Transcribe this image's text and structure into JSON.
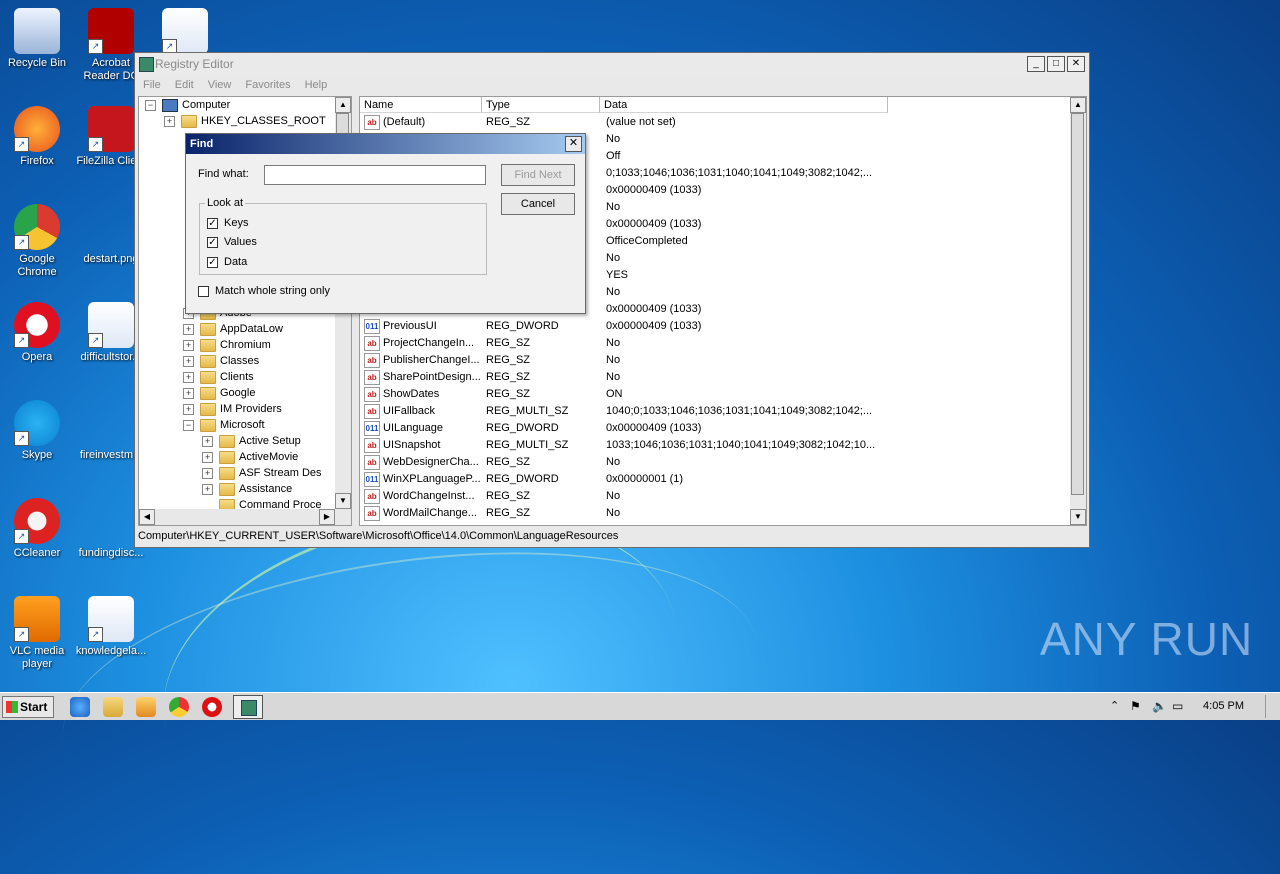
{
  "desktop": {
    "icons": [
      {
        "label": "Recycle Bin",
        "icon": "recycle-bin-icon"
      },
      {
        "label": "Acrobat Reader DC",
        "icon": "acrobat-icon"
      },
      {
        "label": "",
        "icon": "word-doc-icon"
      },
      {
        "label": "Firefox",
        "icon": "firefox-icon"
      },
      {
        "label": "FileZilla Client",
        "icon": "filezilla-icon"
      },
      {
        "label": "Google Chrome",
        "icon": "chrome-icon"
      },
      {
        "label": "destart.png",
        "icon": "image-file-icon"
      },
      {
        "label": "Opera",
        "icon": "opera-icon"
      },
      {
        "label": "difficultstor...",
        "icon": "word-doc-icon"
      },
      {
        "label": "Skype",
        "icon": "skype-icon"
      },
      {
        "label": "fireinvestm...",
        "icon": "file-icon"
      },
      {
        "label": "CCleaner",
        "icon": "ccleaner-icon"
      },
      {
        "label": "fundingdisc...",
        "icon": "file-icon"
      },
      {
        "label": "VLC media player",
        "icon": "vlc-icon"
      },
      {
        "label": "knowledgela...",
        "icon": "word-doc-icon"
      }
    ]
  },
  "window": {
    "title": "Registry Editor",
    "menu": [
      "File",
      "Edit",
      "View",
      "Favorites",
      "Help"
    ],
    "controls": {
      "minimize": "_",
      "maximize": "□",
      "close": "✕"
    }
  },
  "tree": {
    "items": [
      {
        "label": "Computer",
        "level": 0,
        "expander": "−",
        "icon": "computer"
      },
      {
        "label": "HKEY_CLASSES_ROOT",
        "level": 1,
        "expander": "+",
        "icon": "folder"
      },
      {
        "label": "Adobe",
        "level": 2,
        "expander": "+",
        "icon": "folder"
      },
      {
        "label": "AppDataLow",
        "level": 2,
        "expander": "+",
        "icon": "folder"
      },
      {
        "label": "Chromium",
        "level": 2,
        "expander": "+",
        "icon": "folder"
      },
      {
        "label": "Classes",
        "level": 2,
        "expander": "+",
        "icon": "folder"
      },
      {
        "label": "Clients",
        "level": 2,
        "expander": "+",
        "icon": "folder"
      },
      {
        "label": "Google",
        "level": 2,
        "expander": "+",
        "icon": "folder"
      },
      {
        "label": "IM Providers",
        "level": 2,
        "expander": "+",
        "icon": "folder"
      },
      {
        "label": "Microsoft",
        "level": 2,
        "expander": "−",
        "icon": "folder"
      },
      {
        "label": "Active Setup",
        "level": 3,
        "expander": "+",
        "icon": "folder"
      },
      {
        "label": "ActiveMovie",
        "level": 3,
        "expander": "+",
        "icon": "folder"
      },
      {
        "label": "ASF Stream Des",
        "level": 3,
        "expander": "+",
        "icon": "folder"
      },
      {
        "label": "Assistance",
        "level": 3,
        "expander": "+",
        "icon": "folder"
      },
      {
        "label": "Command Proce",
        "level": 3,
        "expander": "",
        "icon": "folder"
      }
    ]
  },
  "list": {
    "columns": [
      "Name",
      "Type",
      "Data"
    ],
    "rows": [
      {
        "name": "(Default)",
        "type": "REG_SZ",
        "data": "(value not set)",
        "icon": "sz"
      },
      {
        "name": "",
        "type": "",
        "data": "No",
        "icon": ""
      },
      {
        "name": "",
        "type": "",
        "data": "Off",
        "icon": ""
      },
      {
        "name": "",
        "type": "",
        "data": "0;1033;1046;1036;1031;1040;1041;1049;3082;1042;...",
        "icon": ""
      },
      {
        "name": "",
        "type": "",
        "data": "0x00000409 (1033)",
        "icon": ""
      },
      {
        "name": "",
        "type": "",
        "data": "No",
        "icon": ""
      },
      {
        "name": "",
        "type": "",
        "data": "0x00000409 (1033)",
        "icon": ""
      },
      {
        "name": "",
        "type": "",
        "data": "OfficeCompleted",
        "icon": ""
      },
      {
        "name": "",
        "type": "",
        "data": "No",
        "icon": ""
      },
      {
        "name": "",
        "type": "",
        "data": "YES",
        "icon": ""
      },
      {
        "name": "",
        "type": "",
        "data": "No",
        "icon": ""
      },
      {
        "name": "",
        "type": "",
        "data": "0x00000409 (1033)",
        "icon": ""
      },
      {
        "name": "PreviousUI",
        "type": "REG_DWORD",
        "data": "0x00000409 (1033)",
        "icon": "dw"
      },
      {
        "name": "ProjectChangeIn...",
        "type": "REG_SZ",
        "data": "No",
        "icon": "sz"
      },
      {
        "name": "PublisherChangeI...",
        "type": "REG_SZ",
        "data": "No",
        "icon": "sz"
      },
      {
        "name": "SharePointDesign...",
        "type": "REG_SZ",
        "data": "No",
        "icon": "sz"
      },
      {
        "name": "ShowDates",
        "type": "REG_SZ",
        "data": "ON",
        "icon": "sz"
      },
      {
        "name": "UIFallback",
        "type": "REG_MULTI_SZ",
        "data": "1040;0;1033;1046;1036;1031;1041;1049;3082;1042;...",
        "icon": "sz"
      },
      {
        "name": "UILanguage",
        "type": "REG_DWORD",
        "data": "0x00000409 (1033)",
        "icon": "dw"
      },
      {
        "name": "UISnapshot",
        "type": "REG_MULTI_SZ",
        "data": "1033;1046;1036;1031;1040;1041;1049;3082;1042;10...",
        "icon": "sz"
      },
      {
        "name": "WebDesignerCha...",
        "type": "REG_SZ",
        "data": "No",
        "icon": "sz"
      },
      {
        "name": "WinXPLanguageP...",
        "type": "REG_DWORD",
        "data": "0x00000001 (1)",
        "icon": "dw"
      },
      {
        "name": "WordChangeInst...",
        "type": "REG_SZ",
        "data": "No",
        "icon": "sz"
      },
      {
        "name": "WordMailChange...",
        "type": "REG_SZ",
        "data": "No",
        "icon": "sz"
      }
    ]
  },
  "status_path": "Computer\\HKEY_CURRENT_USER\\Software\\Microsoft\\Office\\14.0\\Common\\LanguageResources",
  "find_dialog": {
    "title": "Find",
    "close": "✕",
    "find_what_label": "Find what:",
    "find_what_value": "",
    "find_next": "Find Next",
    "cancel": "Cancel",
    "look_at": "Look at",
    "keys": {
      "label": "Keys",
      "checked": true
    },
    "values": {
      "label": "Values",
      "checked": true
    },
    "data": {
      "label": "Data",
      "checked": true
    },
    "match_whole": {
      "label": "Match whole string only",
      "checked": false
    }
  },
  "taskbar": {
    "start": "Start",
    "clock": "4:05 PM"
  },
  "watermark": "ANY RUN",
  "colors": {
    "accent": "#0a246a",
    "desktop": "#1d8fe0"
  }
}
